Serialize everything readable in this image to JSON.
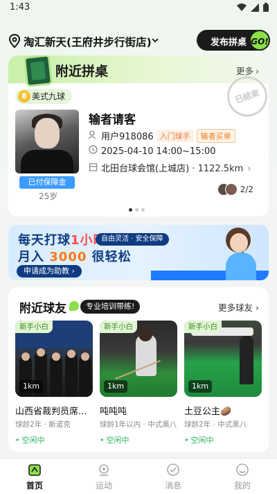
{
  "status_bar": {
    "time": "1:43"
  },
  "header": {
    "store_name": "淘汇新天(王府井步行街店)",
    "publish_label": "发布拼桌",
    "publish_badge": "GO!"
  },
  "nearby_tables": {
    "title": "附近拼桌",
    "more_label": "更多",
    "ended_stamp": "已结束",
    "game_type": "美式九球",
    "ball_number": "8",
    "player": {
      "deposit_badge": "已付保障金",
      "age": "25岁"
    },
    "match_title": "输者请客",
    "user_label": "用户918086",
    "level_chip": "入门球手",
    "rule_chip": "输者买单",
    "time_range": "2025-04-10 14:00~15:00",
    "venue": "北田台球会馆(上城店)",
    "separator": "·",
    "distance": "1122.5km",
    "page_indicator": "2/2",
    "carousel_pages": 3,
    "carousel_active": 0
  },
  "banner": {
    "line1_prefix": "每天打球",
    "line1_highlight": "1小时",
    "line2_prefix": "月入",
    "line2_highlight": "3000",
    "line2_suffix": "很轻松",
    "pill": "自由灵活 · 安全保障",
    "cta": "申请成为助教 ›"
  },
  "nearby_players": {
    "title": "附近球友",
    "train_pill": "专业培训带练!",
    "more_label": "更多球友",
    "players": [
      {
        "tag": "新手小白",
        "distance": "1km",
        "name": "山西省裁判员席...",
        "meta": "球龄2年 · 斯诺克",
        "state": "空闲中"
      },
      {
        "tag": "新手小白",
        "distance": "1km",
        "name": "吨吨吨",
        "meta": "球龄1年以内 · 中式黑八",
        "state": "空闲中"
      },
      {
        "tag": "新手小白",
        "distance": "1km",
        "name": "土豆公主🥔",
        "meta": "球龄2年 · 中式黑八",
        "state": "空闲中"
      }
    ]
  },
  "bottom_nav": {
    "items": [
      {
        "label": "首页",
        "icon": "home-icon",
        "active": true
      },
      {
        "label": "运动",
        "icon": "sport-icon",
        "active": false
      },
      {
        "label": "消息",
        "icon": "message-icon",
        "active": false
      },
      {
        "label": "我的",
        "icon": "profile-icon",
        "active": false
      }
    ]
  },
  "colors": {
    "accent_green": "#8be04a",
    "dark": "#1b1b1b",
    "deposit_blue": "#3c9bff",
    "idle_green": "#2bb062"
  }
}
